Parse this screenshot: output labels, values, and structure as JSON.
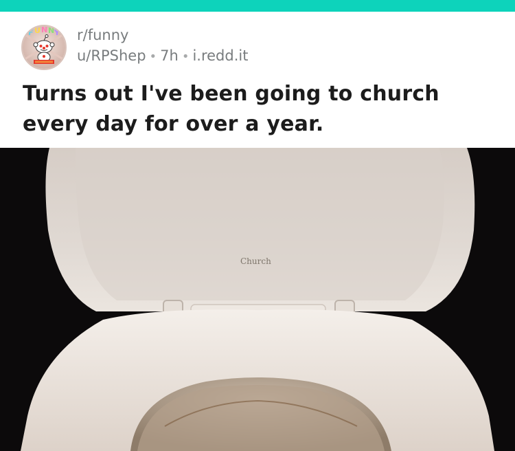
{
  "post": {
    "subreddit": "r/funny",
    "author": "u/RPShep",
    "age": "7h",
    "domain": "i.redd.it",
    "separator": "•",
    "title": "Turns out I've been going to church every day for over a year.",
    "image_text": "Church"
  },
  "colors": {
    "top_bar": "#0dd3bb",
    "meta_text": "#787c7e",
    "title_text": "#1c1c1c"
  },
  "icons": {
    "avatar": "subreddit-avatar-icon"
  }
}
